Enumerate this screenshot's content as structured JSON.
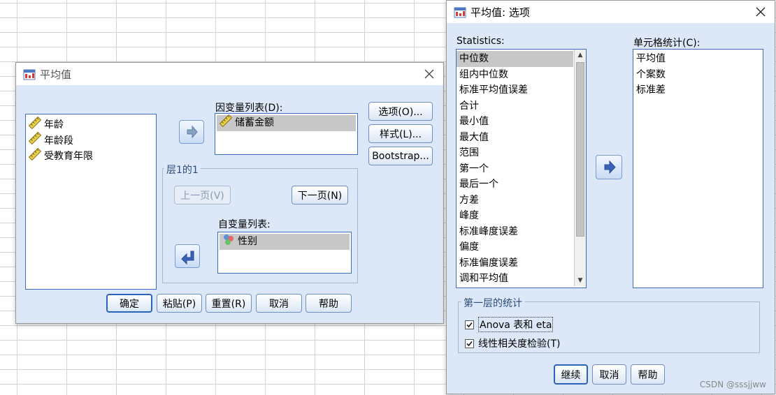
{
  "dialog1": {
    "title": "平均值",
    "source_vars": [
      "年龄",
      "年龄段",
      "受教育年限"
    ],
    "dep_label": "因变量列表(D):",
    "dep_items": [
      "储蓄金额"
    ],
    "layer_title": "层1的1",
    "prev_label": "上一页(V)",
    "next_label": "下一页(N)",
    "indep_label": "自变量列表:",
    "indep_items": [
      "性别"
    ],
    "side_buttons": {
      "options": "选项(O)...",
      "style": "样式(L)...",
      "bootstrap": "Bootstrap..."
    },
    "bottom_buttons": {
      "ok": "确定",
      "paste": "粘贴(P)",
      "reset": "重置(R)",
      "cancel": "取消",
      "help": "帮助"
    }
  },
  "dialog2": {
    "title": "平均值: 选项",
    "stats_label": "Statistics:",
    "stats": [
      "中位数",
      "组内中位数",
      "标准平均值误差",
      "合计",
      "最小值",
      "最大值",
      "范围",
      "第一个",
      "最后一个",
      "方差",
      "峰度",
      "标准峰度误差",
      "偏度",
      "标准偏度误差",
      "调和平均值"
    ],
    "cell_label": "单元格统计(C):",
    "cell_stats": [
      "平均值",
      "个案数",
      "标准差"
    ],
    "group_title": "第一层的统计",
    "anova_label": "Anova 表和 eta",
    "linearity_label": "线性相关度检验(T)",
    "anova_checked": true,
    "linearity_checked": true,
    "buttons": {
      "continue": "继续",
      "cancel": "取消",
      "help": "帮助"
    }
  },
  "watermark": "CSDN @sssjjww",
  "colors": {
    "dialog_bg": "#dce8f7",
    "list_border": "#3c6dbd",
    "selection": "#c8c8c8"
  }
}
